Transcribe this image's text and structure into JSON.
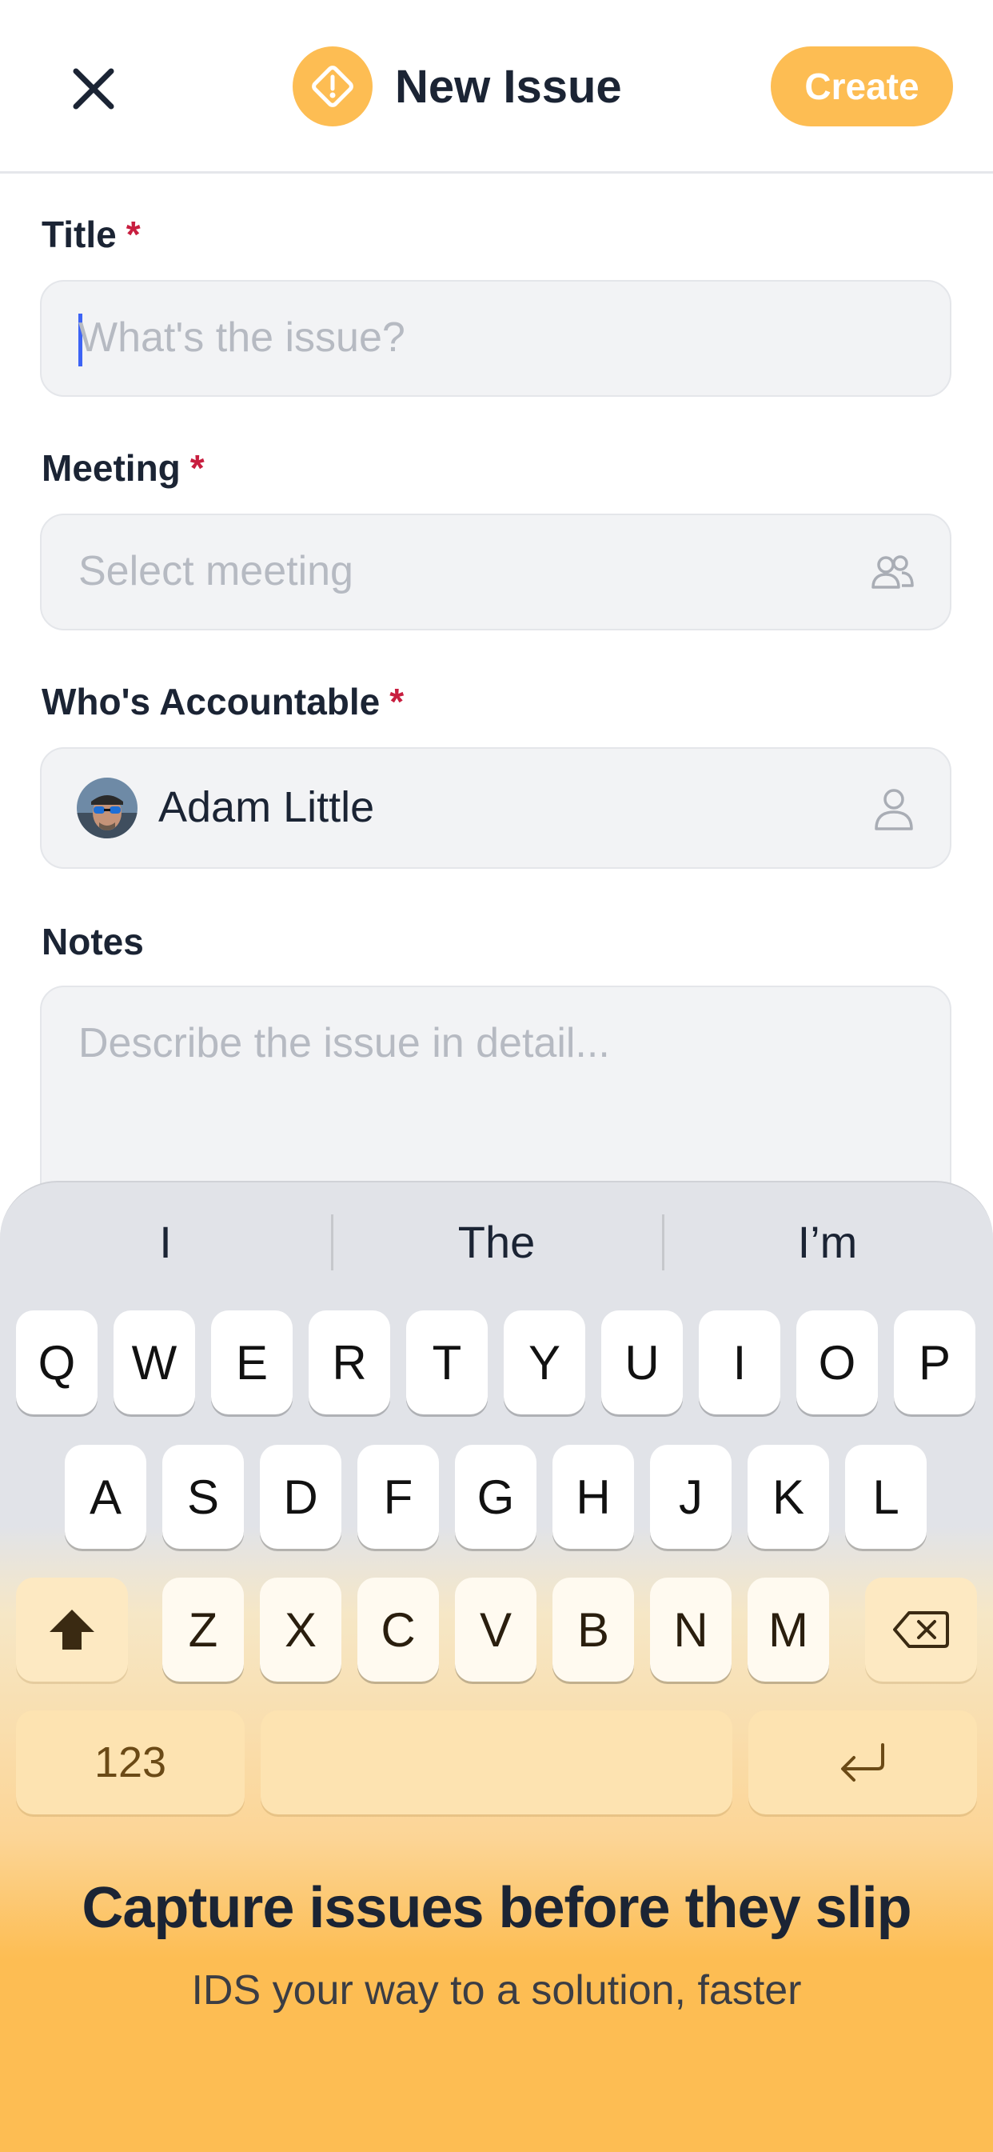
{
  "header": {
    "close_icon": "close-icon",
    "title": "New Issue",
    "title_icon": "warning-diamond-icon",
    "create_label": "Create"
  },
  "form": {
    "title": {
      "label": "Title",
      "required": "*",
      "placeholder": "What's the issue?"
    },
    "meeting": {
      "label": "Meeting",
      "required": "*",
      "placeholder": "Select meeting",
      "icon": "people-icon"
    },
    "accountable": {
      "label": "Who's Accountable",
      "required": "*",
      "value": "Adam Little",
      "icon": "person-icon"
    },
    "notes": {
      "label": "Notes",
      "placeholder": "Describe the issue in detail..."
    }
  },
  "keyboard": {
    "suggestions": [
      "I",
      "The",
      "I’m"
    ],
    "row1": [
      "Q",
      "W",
      "E",
      "R",
      "T",
      "Y",
      "U",
      "I",
      "O",
      "P"
    ],
    "row2": [
      "A",
      "S",
      "D",
      "F",
      "G",
      "H",
      "J",
      "K",
      "L"
    ],
    "row3": [
      "Z",
      "X",
      "C",
      "V",
      "B",
      "N",
      "M"
    ],
    "numbers_label": "123",
    "shift_icon": "shift-icon",
    "delete_icon": "backspace-icon",
    "return_icon": "return-icon"
  },
  "promo": {
    "title": "Capture issues before they slip",
    "subtitle": "IDS your way to a solution, faster"
  },
  "colors": {
    "accent": "#fdbd53",
    "required": "#c81e3f",
    "caret": "#3d63f5"
  }
}
